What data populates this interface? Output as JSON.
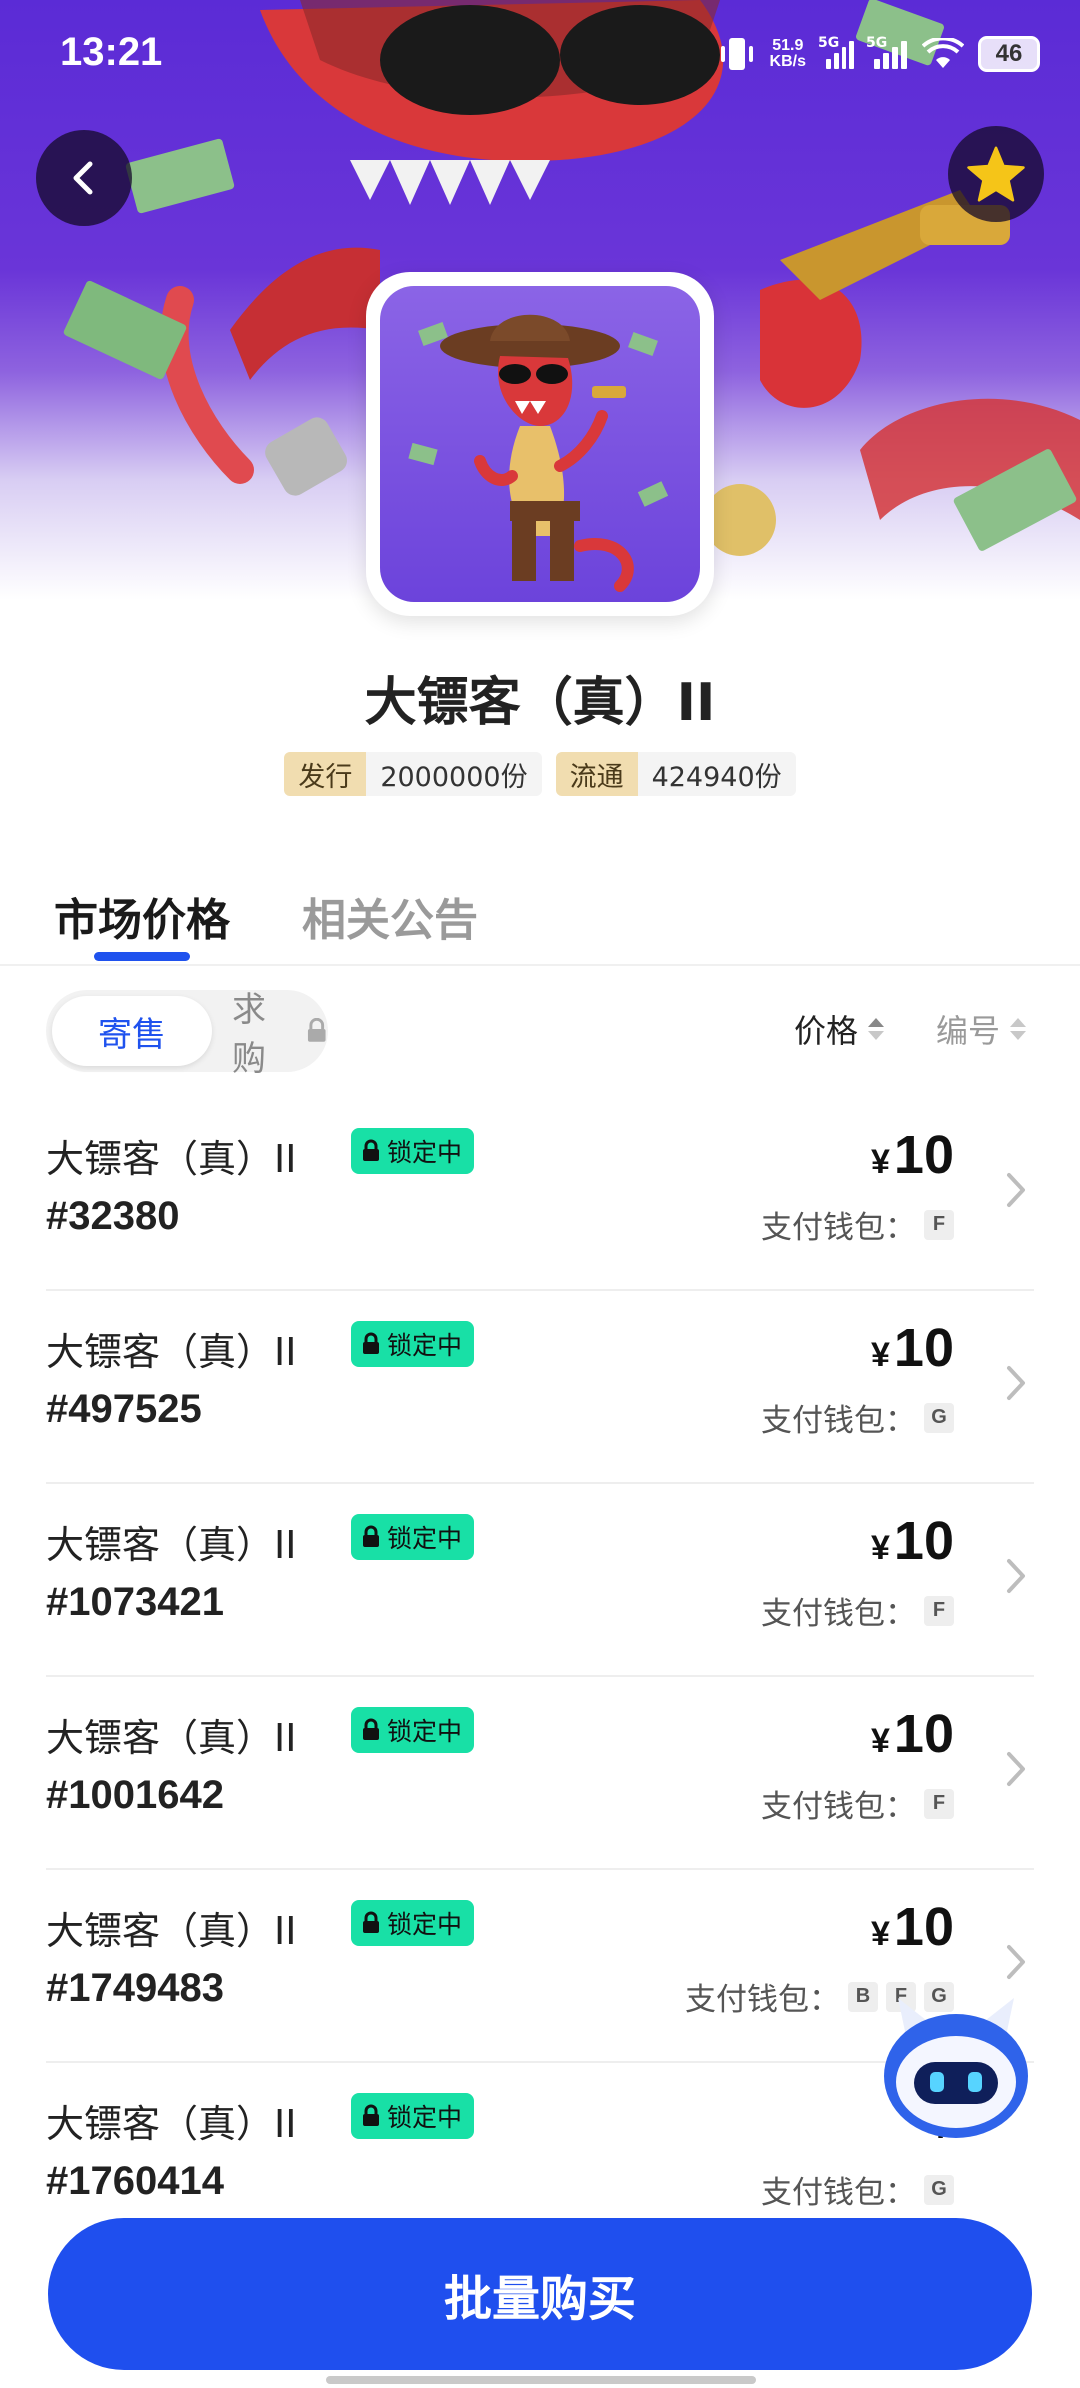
{
  "status_bar": {
    "time": "13:21",
    "net_speed_value": "51.9",
    "net_speed_unit": "KB/s",
    "sim1": "5G",
    "sim2": "5G",
    "battery": "46"
  },
  "header": {
    "back_icon": "chevron-left-icon",
    "favorite_icon": "star-icon",
    "favorite_color": "#f5c518"
  },
  "item": {
    "title": "大镖客（真）II",
    "issued_label": "发行",
    "issued_value": "2000000份",
    "circulation_label": "流通",
    "circulation_value": "424940份"
  },
  "tabs": [
    {
      "label": "市场价格",
      "active": true
    },
    {
      "label": "相关公告",
      "active": false
    }
  ],
  "filter": {
    "sell_label": "寄售",
    "buy_label": "求购",
    "buy_locked_icon": "lock-icon",
    "sort_price_label": "价格",
    "sort_number_label": "编号"
  },
  "listings": [
    {
      "name": "大镖客（真）II",
      "status": "锁定中",
      "number": "#32380",
      "currency": "¥",
      "price": "10",
      "wallet_label": "支付钱包：",
      "wallets": [
        "F"
      ]
    },
    {
      "name": "大镖客（真）II",
      "status": "锁定中",
      "number": "#497525",
      "currency": "¥",
      "price": "10",
      "wallet_label": "支付钱包：",
      "wallets": [
        "G"
      ]
    },
    {
      "name": "大镖客（真）II",
      "status": "锁定中",
      "number": "#1073421",
      "currency": "¥",
      "price": "10",
      "wallet_label": "支付钱包：",
      "wallets": [
        "F"
      ]
    },
    {
      "name": "大镖客（真）II",
      "status": "锁定中",
      "number": "#1001642",
      "currency": "¥",
      "price": "10",
      "wallet_label": "支付钱包：",
      "wallets": [
        "F"
      ]
    },
    {
      "name": "大镖客（真）II",
      "status": "锁定中",
      "number": "#1749483",
      "currency": "¥",
      "price": "10",
      "wallet_label": "支付钱包：",
      "wallets": [
        "B",
        "F",
        "G"
      ]
    },
    {
      "name": "大镖客（真）II",
      "status": "锁定中",
      "number": "#1760414",
      "currency": "¥",
      "price": "",
      "wallet_label": "支付钱包：",
      "wallets": [
        "G"
      ]
    }
  ],
  "bulk_buy_label": "批量购买",
  "colors": {
    "accent": "#1f4fee",
    "lock_badge": "#18e0a6",
    "stat_key_bg": "#f1ddb0"
  }
}
